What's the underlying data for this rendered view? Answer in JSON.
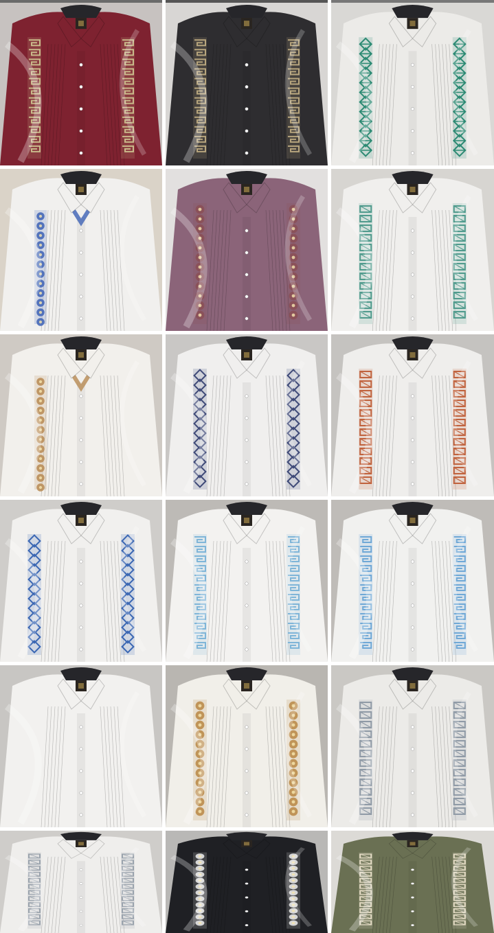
{
  "gallery": {
    "tiles": [
      {
        "shirt": "#7e2230",
        "bg": "#c7c2c0",
        "embroidery": "#c9b98a",
        "motif": "greek-key",
        "style": "two-bands"
      },
      {
        "shirt": "#2e2d30",
        "bg": "#d8d6d4",
        "embroidery": "#b7a57d",
        "motif": "greek-key",
        "style": "two-bands"
      },
      {
        "shirt": "#ecebe8",
        "bg": "#d9d8d5",
        "embroidery": "#2c8a73",
        "motif": "star",
        "style": "two-bands"
      },
      {
        "shirt": "#f1f0ee",
        "bg": "#dad3c8",
        "embroidery": "#3d62b5",
        "motif": "floral",
        "style": "v-neck"
      },
      {
        "shirt": "#8b6479",
        "bg": "#e2e0df",
        "embroidery": "#8a4f55",
        "motif": "floral",
        "style": "two-bands"
      },
      {
        "shirt": "#f0efed",
        "bg": "#d7d5d1",
        "embroidery": "#4f9a8c",
        "motif": "geo",
        "style": "two-bands"
      },
      {
        "shirt": "#f2f0ec",
        "bg": "#cfcac4",
        "embroidery": "#b78a52",
        "motif": "floral",
        "style": "v-neck"
      },
      {
        "shirt": "#f0efee",
        "bg": "#c9c7c5",
        "embroidery": "#3f4a78",
        "motif": "diamond",
        "style": "two-bands"
      },
      {
        "shirt": "#efeeec",
        "bg": "#c5c3c0",
        "embroidery": "#c0623d",
        "motif": "geo",
        "style": "two-bands"
      },
      {
        "shirt": "#f1f0ee",
        "bg": "#cfcdca",
        "embroidery": "#3b67b3",
        "motif": "diamond",
        "style": "two-bands"
      },
      {
        "shirt": "#f3f2f0",
        "bg": "#bdbab6",
        "embroidery": "#7fb5d8",
        "motif": "greek-key",
        "style": "two-bands"
      },
      {
        "shirt": "#f1f1ef",
        "bg": "#bfbcb8",
        "embroidery": "#6fa8d6",
        "motif": "greek-key",
        "style": "two-bands"
      },
      {
        "shirt": "#f2f1ef",
        "bg": "#c8c6c3",
        "embroidery": "#e4e2df",
        "motif": "plain",
        "style": "plain"
      },
      {
        "shirt": "#f1efe9",
        "bg": "#b9b6b1",
        "embroidery": "#b98744",
        "motif": "floral",
        "style": "two-bands"
      },
      {
        "shirt": "#ecebe8",
        "bg": "#cac8c4",
        "embroidery": "#8f9aa6",
        "motif": "geo",
        "style": "two-bands"
      },
      {
        "shirt": "#efeeec",
        "bg": "#cfcdca",
        "embroidery": "#9aa3ad",
        "motif": "geo",
        "style": "two-bands"
      },
      {
        "shirt": "#1f2024",
        "bg": "#b9b8b6",
        "embroidery": "#f0f0f0",
        "motif": "floral",
        "style": "two-bands"
      },
      {
        "shirt": "#6a7053",
        "bg": "#dcdad6",
        "embroidery": "#e6ddc6",
        "motif": "geo",
        "style": "two-bands"
      }
    ]
  }
}
